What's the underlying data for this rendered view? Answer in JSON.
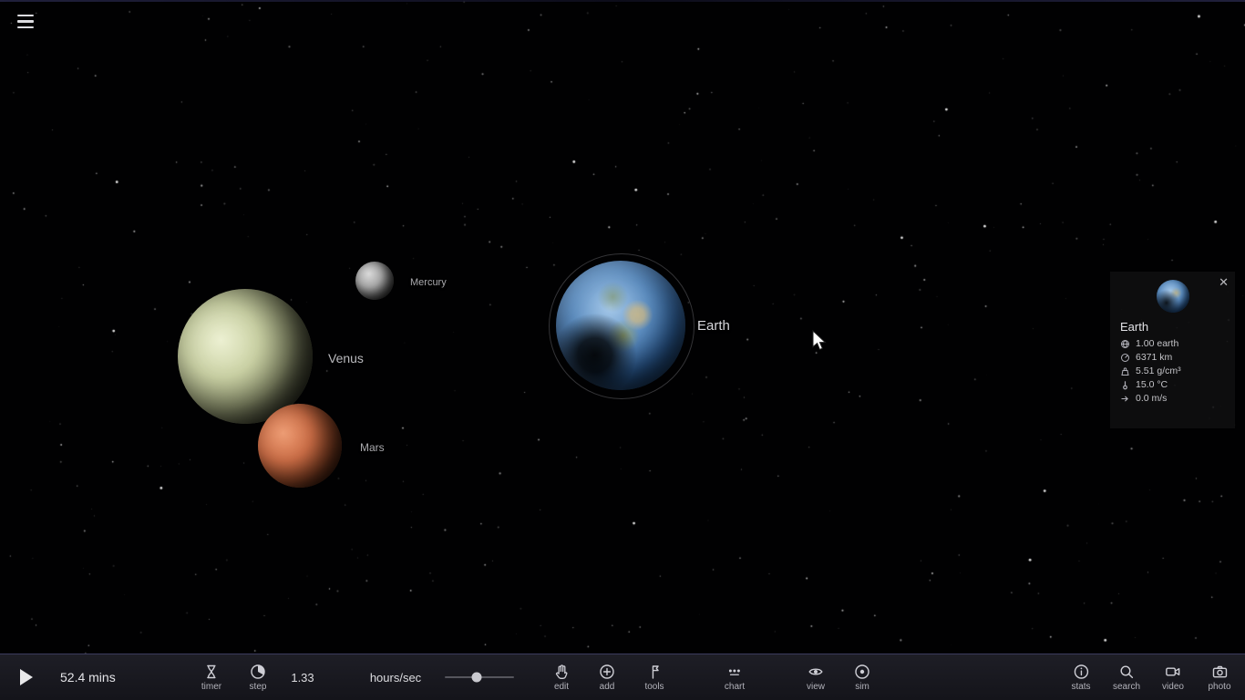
{
  "scene": {
    "labels": {
      "mercury": "Mercury",
      "venus": "Venus",
      "mars": "Mars",
      "earth": "Earth"
    }
  },
  "info_panel": {
    "title": "Earth",
    "close": "✕",
    "properties": [
      {
        "name": "mass",
        "icon": "mass-icon",
        "value": "1.00 earth"
      },
      {
        "name": "radius",
        "icon": "radius-icon",
        "value": "6371 km"
      },
      {
        "name": "density",
        "icon": "density-icon",
        "value": "5.51 g/cm³"
      },
      {
        "name": "temperature",
        "icon": "temperature-icon",
        "value": "15.0 °C"
      },
      {
        "name": "velocity",
        "icon": "velocity-icon",
        "value": "0.0 m/s"
      }
    ]
  },
  "toolbar": {
    "elapsed": "52.4 mins",
    "rate_value": "1.33",
    "rate_unit": "hours/sec",
    "buttons": {
      "timer": "timer",
      "step": "step",
      "edit": "edit",
      "add": "add",
      "tools": "tools",
      "chart": "chart",
      "view": "view",
      "sim": "sim",
      "stats": "stats",
      "search": "search",
      "video": "video",
      "photo": "photo"
    }
  },
  "colors": {
    "toolbar_border": "#3c3c5e",
    "selection_ring": "#9a9aa5",
    "star": "#ffffff"
  }
}
